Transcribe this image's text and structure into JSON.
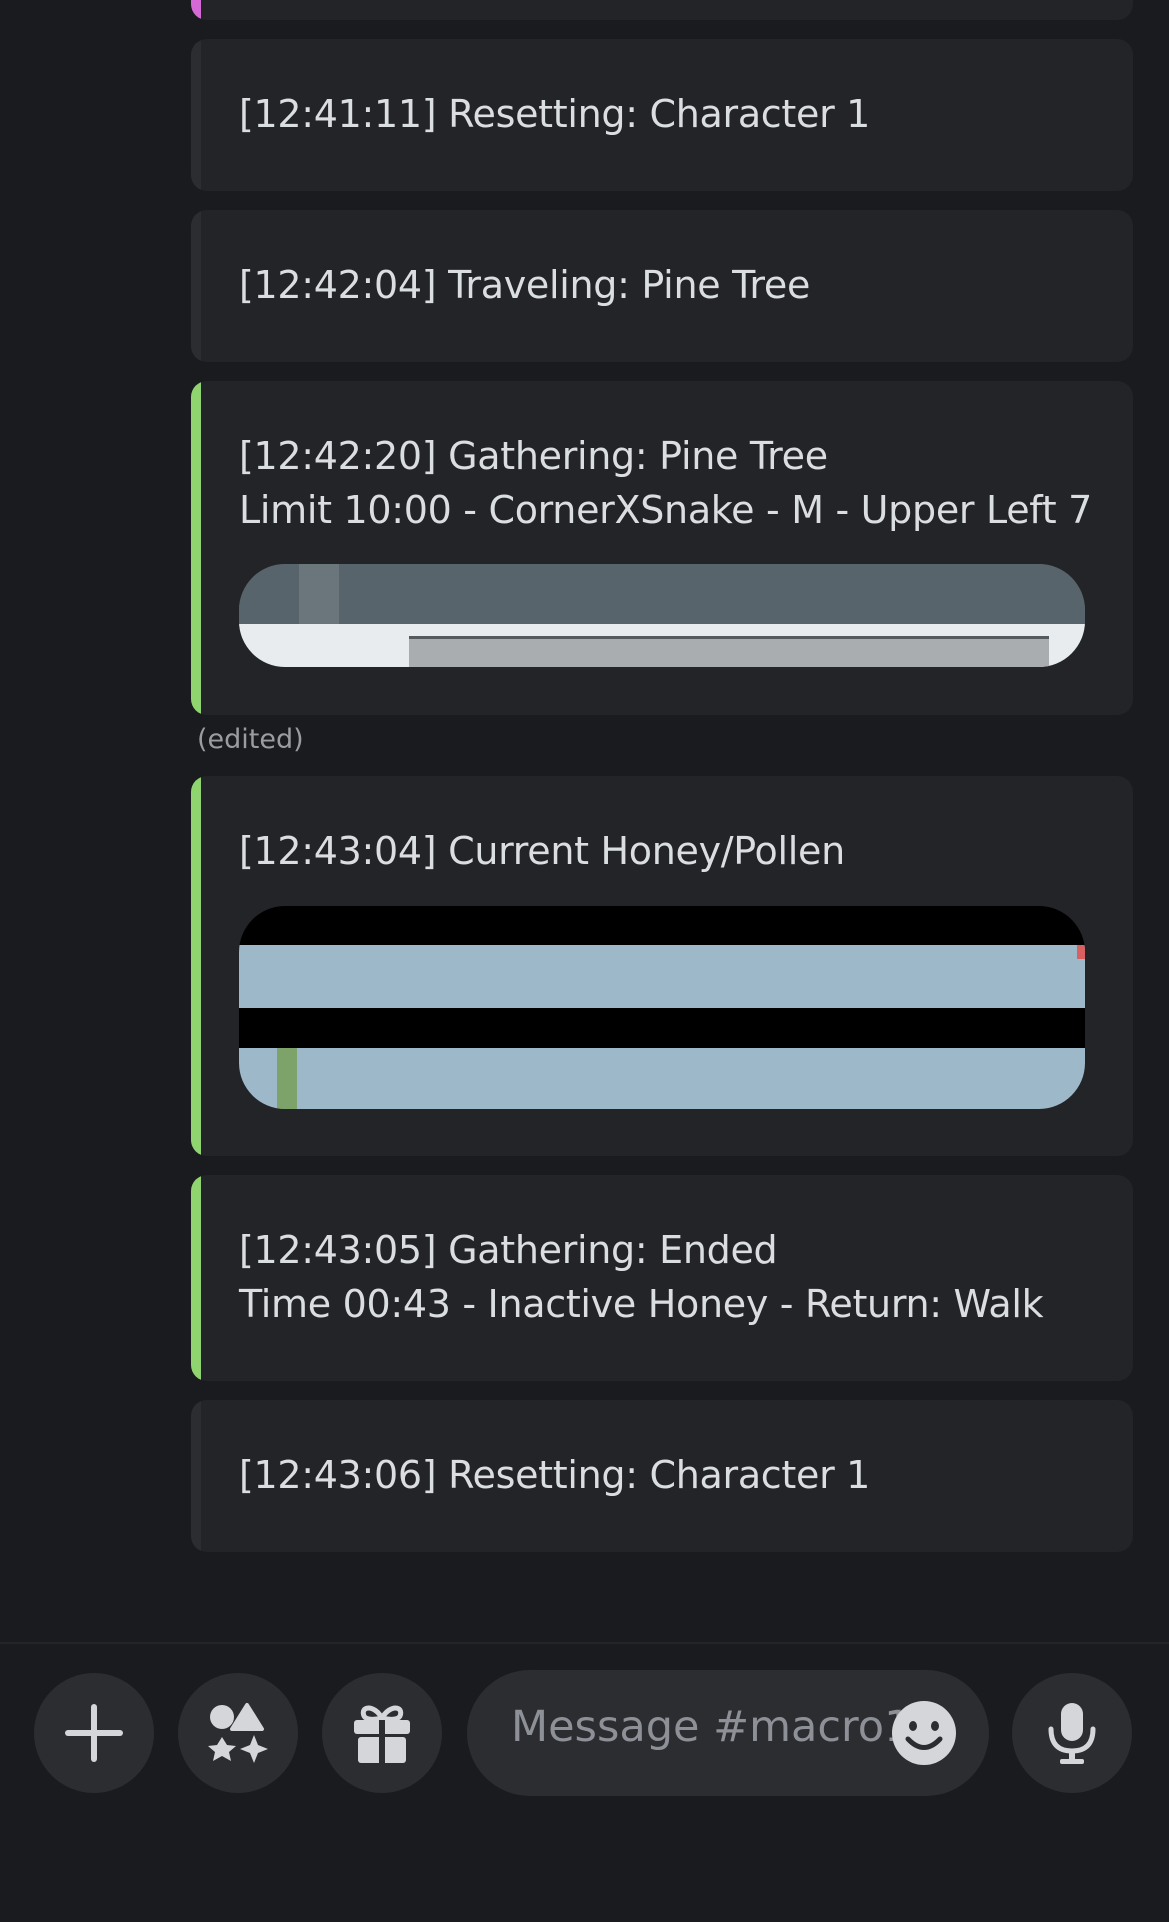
{
  "messages": [
    {
      "lines": [
        "[12:41:11] Resetting: Character 1"
      ]
    },
    {
      "lines": [
        "[12:42:04] Traveling: Pine Tree"
      ]
    },
    {
      "lines": [
        "[12:42:20] Gathering: Pine Tree",
        "Limit 10:00 - CornerXSnake - M - Upper Left 7"
      ]
    },
    {
      "lines": [
        "[12:43:04] Current Honey/Pollen"
      ]
    },
    {
      "lines": [
        "[12:43:05] Gathering: Ended",
        "Time 00:43 - Inactive Honey - Return: Walk"
      ]
    },
    {
      "lines": [
        "[12:43:06] Resetting: Character 1"
      ]
    }
  ],
  "edited_label": "(edited)",
  "composer": {
    "placeholder": "Message #macro1",
    "buttons": {
      "add": "plus-icon",
      "apps": "apps-icon",
      "gift": "gift-icon",
      "emoji": "emoji-icon",
      "voice": "microphone-icon"
    }
  },
  "colors": {
    "background": "#1a1b1e",
    "embed": "#232428",
    "accent_green": "#8fd46e",
    "accent_pink": "#d56ad6",
    "text": "#dbdee1",
    "muted": "#9a9ca2"
  }
}
